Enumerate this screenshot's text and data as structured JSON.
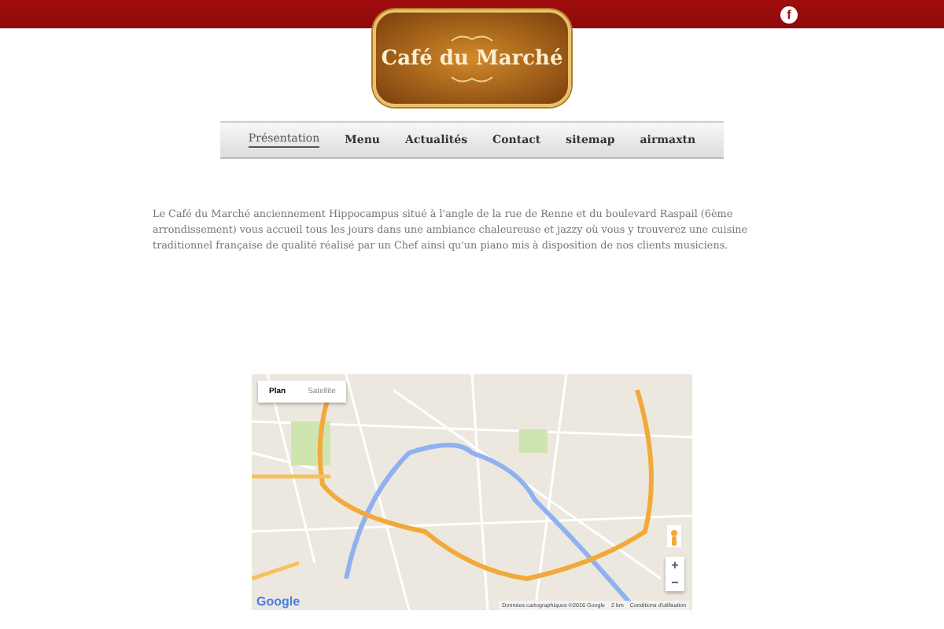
{
  "logo": {
    "text": "Café du Marché"
  },
  "social": {
    "label": "f"
  },
  "nav": [
    {
      "label": "Présentation",
      "selected": true
    },
    {
      "label": "Menu",
      "selected": false
    },
    {
      "label": "Actualités",
      "selected": false
    },
    {
      "label": "Contact",
      "selected": false
    },
    {
      "label": "sitemap",
      "selected": false
    },
    {
      "label": "airmaxtn",
      "selected": false
    }
  ],
  "intro": "Le Café du Marché anciennement Hippocampus situé à l'angle de la rue de Renne et du boulevard Raspail (6ème arrondissement) vous accueil tous les jours dans une ambiance chaleureuse et jazzy où vous y trouverez une cuisine traditionnel française de qualité réalisé par un Chef ainsi qu'un piano mis à disposition de nos clients musiciens.",
  "map": {
    "types": [
      {
        "label": "Plan",
        "selected": true
      },
      {
        "label": "Satellite",
        "selected": false
      }
    ],
    "zoom_in": "+",
    "zoom_out": "−",
    "brand": "Google",
    "attribution": "Données cartographiques ©2016 Google",
    "scale": "2 km",
    "terms": "Conditions d'utilisation"
  }
}
